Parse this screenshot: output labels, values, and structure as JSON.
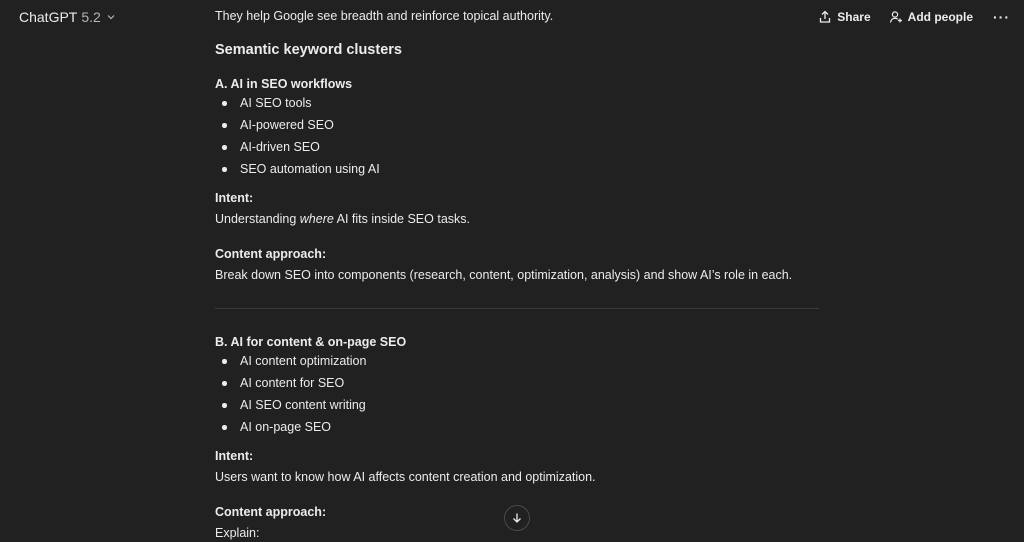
{
  "header": {
    "model_name": "ChatGPT",
    "model_version": "5.2",
    "share_label": "Share",
    "add_people_label": "Add people",
    "more_label": "···"
  },
  "message": {
    "intro_line": "They help Google see breadth and reinforce topical authority.",
    "section_title": "Semantic keyword clusters",
    "cluster_a": {
      "title": "A. AI in SEO workflows",
      "keywords": [
        "AI SEO tools",
        "AI-powered SEO",
        "AI-driven SEO",
        "SEO automation using AI"
      ],
      "intent_label": "Intent:",
      "intent_pre": "Understanding ",
      "intent_em": "where",
      "intent_post": " AI fits inside SEO tasks.",
      "approach_label": "Content approach:",
      "approach_text": "Break down SEO into components (research, content, optimization, analysis) and show AI’s role in each."
    },
    "cluster_b": {
      "title": "B. AI for content & on-page SEO",
      "keywords": [
        "AI content optimization",
        "AI content for SEO",
        "AI SEO content writing",
        "AI on-page SEO"
      ],
      "intent_label": "Intent:",
      "intent_text": "Users want to know how AI affects content creation and optimization.",
      "approach_label": "Content approach:",
      "approach_text": "Explain:"
    }
  }
}
